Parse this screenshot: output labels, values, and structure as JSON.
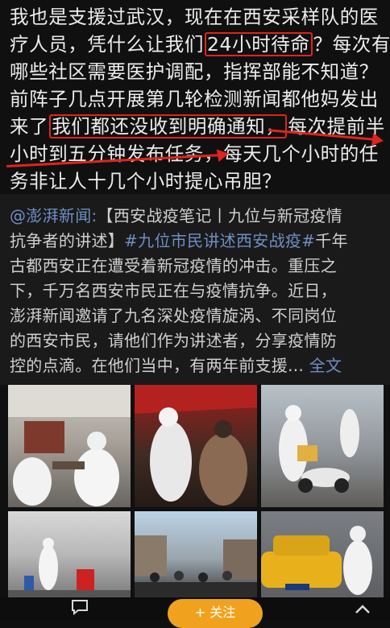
{
  "post": {
    "line1": "我也是支援过武汉，现在在西安采样队的医",
    "line2_a": "疗人员，凭什么让我们",
    "line2_hl": "24小时待命",
    "line2_b": "？每次有",
    "line3": "哪些社区需要医护调配，指挥部能不知道？",
    "line4": "前阵子几点开展第几轮检测新闻都他妈发出",
    "line5_a": "来了",
    "line5_hl": "我们都还没收到明确通知，",
    "line5_b": "每次提前半",
    "line6_a": "小时到五分钟发布任务，",
    "line6_b": "每天几个小时的任",
    "line7": "务非让人十几个小时提心吊胆？"
  },
  "repost": {
    "line1_source": "@澎湃新闻:",
    "line1_rest": "【西安战疫笔记丨九位与新冠疫情",
    "line2_a": "抗争者的讲述】",
    "line2_tag": "#九位市民讲述西安战疫#",
    "line2_b": "千年",
    "line3": "古都西安正在遭受着新冠疫情的冲击。重压之",
    "line4": "下，千万名西安市民正在与疫情抗争。近日，",
    "line5": "澎湃新闻邀请了九名深处疫情旋涡、不同岗位",
    "line6": "的西安市民，请他们作为讲述者，分享疫情防",
    "line7_a": "控的点滴。在他们当中，有两年前支援...",
    "line7_more": "全文"
  },
  "photos": [
    {
      "name": "photo-office-ppe"
    },
    {
      "name": "photo-swab-test-tent"
    },
    {
      "name": "photo-scooter-delivery"
    },
    {
      "name": "photo-disinfection-spray"
    },
    {
      "name": "photo-street-queue"
    },
    {
      "name": "photo-taxi-worker"
    }
  ],
  "bottom_bar": {
    "follow_label": "+ 关注",
    "comment_icon": "comment-icon",
    "up_icon": "chevron-up-icon"
  },
  "colors": {
    "highlight": "#e0241c",
    "link": "#6e8fc4",
    "accent": "#f0a21e"
  }
}
